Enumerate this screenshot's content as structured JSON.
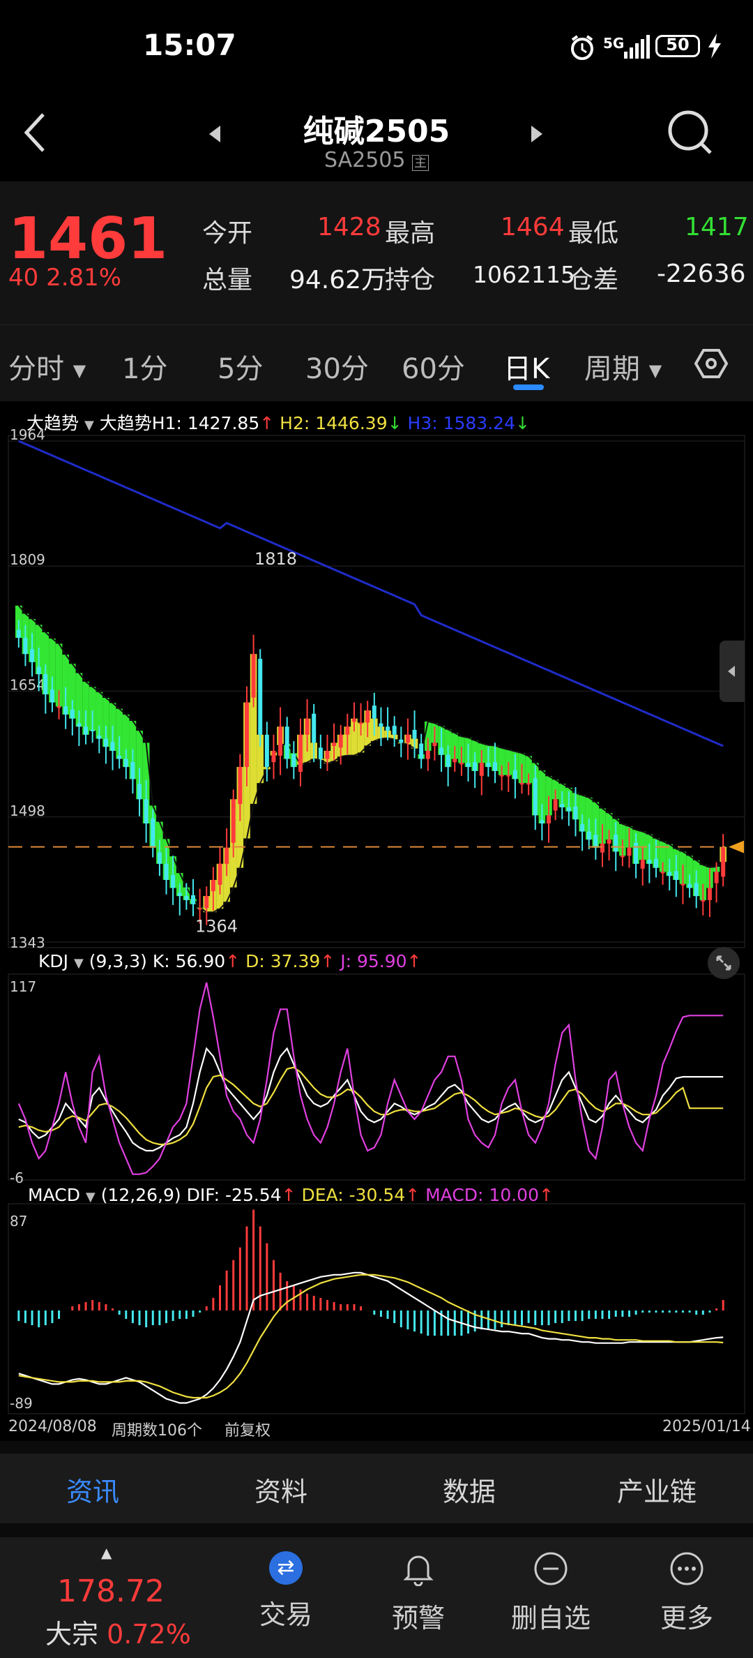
{
  "status": {
    "time": "15:07",
    "network": "5G",
    "battery": "50"
  },
  "header": {
    "title": "纯碱2505",
    "subtitle": "SA2505",
    "badge": "主"
  },
  "quote": {
    "price": "1461",
    "change": "40",
    "change_pct": "2.81%",
    "open_label": "今开",
    "open": "1428",
    "high_label": "最高",
    "high": "1464",
    "low_label": "最低",
    "low": "1417",
    "vol_label": "总量",
    "vol": "94.62万",
    "oi_label": "持仓",
    "oi": "1062115",
    "oi_diff_label": "仓差",
    "oi_diff": "-22636"
  },
  "tabs": [
    "分时",
    "1分",
    "5分",
    "30分",
    "60分",
    "日K",
    "周期"
  ],
  "active_tab": "日K",
  "main_legend": {
    "name": "大趋势",
    "h1": "大趋势H1: 1427.85",
    "h2": "H2: 1446.39",
    "h3": "H3: 1583.24"
  },
  "kdj_legend": {
    "name": "KDJ",
    "params": "(9,3,3)",
    "k": "K: 56.90",
    "d": "D: 37.39",
    "j": "J: 95.90"
  },
  "macd_legend": {
    "name": "MACD",
    "params": "(12,26,9)",
    "dif": "DIF: -25.54",
    "dea": "DEA: -30.54",
    "macd": "MACD: 10.00"
  },
  "bottom_info": {
    "start": "2024/08/08",
    "count": "周期数106个",
    "adj": "前复权",
    "end": "2025/01/14"
  },
  "bottom_tabs": [
    "资讯",
    "资料",
    "数据",
    "产业链"
  ],
  "footer": {
    "index_value": "178.72",
    "index_name": "大宗",
    "index_pct": "0.72%",
    "items": [
      "交易",
      "预警",
      "删自选",
      "更多"
    ]
  },
  "colors": {
    "up": "#ff3b3b",
    "down": "#44e8ee",
    "band_down": "#39ff39",
    "band_up": "#f5f53a",
    "h3": "#1f2cc8"
  },
  "chart_data": [
    {
      "type": "candlestick",
      "title": "",
      "ylim": [
        1343,
        1964
      ],
      "y_ticks": [
        "1964",
        "1809",
        "1654",
        "1498",
        "1343"
      ],
      "annotations": [
        "1818",
        "1364"
      ],
      "x_range": [
        "2024/08/08",
        "2025/01/14"
      ],
      "periods": 106,
      "last_close": 1461,
      "close": [
        1720,
        1700,
        1690,
        1675,
        1650,
        1640,
        1635,
        1625,
        1620,
        1610,
        1600,
        1605,
        1595,
        1585,
        1580,
        1570,
        1560,
        1545,
        1520,
        1490,
        1460,
        1440,
        1420,
        1410,
        1400,
        1395,
        1390,
        1385,
        1400,
        1420,
        1440,
        1460,
        1520,
        1560,
        1640,
        1700,
        1600,
        1560,
        1580,
        1610,
        1570,
        1560,
        1600,
        1620,
        1590,
        1570,
        1580,
        1590,
        1600,
        1610,
        1620,
        1615,
        1630,
        1620,
        1610,
        1605,
        1600,
        1590,
        1600,
        1595,
        1570,
        1580,
        1590,
        1575,
        1560,
        1570,
        1565,
        1560,
        1555,
        1565,
        1560,
        1555,
        1550,
        1550,
        1545,
        1540,
        1540,
        1500,
        1490,
        1500,
        1520,
        1510,
        1505,
        1495,
        1480,
        1470,
        1460,
        1465,
        1470,
        1455,
        1450,
        1460,
        1440,
        1445,
        1440,
        1435,
        1430,
        1425,
        1420,
        1415,
        1410,
        1400,
        1395,
        1410,
        1430,
        1461
      ]
    },
    {
      "type": "line",
      "title": "",
      "ylim": [
        -6,
        117
      ],
      "y_ticks": [
        "117",
        "-6"
      ],
      "series": [
        {
          "name": "K",
          "values": [
            30,
            28,
            22,
            18,
            20,
            25,
            30,
            40,
            35,
            30,
            25,
            45,
            50,
            42,
            35,
            28,
            22,
            15,
            12,
            10,
            10,
            12,
            15,
            18,
            20,
            25,
            40,
            60,
            75,
            70,
            60,
            50,
            45,
            40,
            35,
            30,
            35,
            45,
            60,
            70,
            75,
            65,
            55,
            45,
            40,
            38,
            40,
            45,
            50,
            55,
            45,
            35,
            30,
            28,
            30,
            35,
            40,
            38,
            35,
            33,
            35,
            38,
            40,
            45,
            50,
            52,
            48,
            40,
            35,
            30,
            28,
            30,
            35,
            38,
            40,
            35,
            30,
            28,
            30,
            35,
            45,
            55,
            60,
            50,
            40,
            30,
            28,
            32,
            40,
            45,
            40,
            35,
            30,
            28,
            32,
            36,
            45,
            50,
            56,
            57,
            57,
            57,
            57,
            57,
            57,
            57
          ]
        },
        {
          "name": "D",
          "values": [
            25,
            26,
            25,
            23,
            22,
            23,
            25,
            30,
            32,
            31,
            29,
            34,
            39,
            40,
            38,
            35,
            31,
            26,
            21,
            17,
            15,
            14,
            14,
            15,
            17,
            20,
            27,
            38,
            50,
            57,
            58,
            55,
            52,
            48,
            44,
            40,
            38,
            40,
            47,
            55,
            62,
            63,
            60,
            55,
            50,
            46,
            44,
            44,
            46,
            49,
            48,
            44,
            39,
            35,
            33,
            33,
            35,
            36,
            36,
            35,
            35,
            36,
            37,
            40,
            43,
            46,
            47,
            45,
            42,
            38,
            35,
            33,
            34,
            35,
            37,
            36,
            34,
            32,
            31,
            32,
            36,
            42,
            48,
            49,
            46,
            41,
            37,
            35,
            37,
            40,
            40,
            38,
            35,
            33,
            33,
            34,
            38,
            42,
            47,
            50,
            37,
            37,
            37,
            37,
            37,
            37
          ]
        },
        {
          "name": "J",
          "values": [
            40,
            30,
            15,
            5,
            10,
            25,
            40,
            60,
            40,
            25,
            15,
            60,
            70,
            45,
            30,
            15,
            5,
            -5,
            -5,
            -4,
            0,
            5,
            15,
            25,
            30,
            40,
            70,
            100,
            117,
            95,
            70,
            45,
            35,
            30,
            20,
            15,
            30,
            55,
            85,
            100,
            100,
            70,
            45,
            30,
            20,
            15,
            25,
            40,
            60,
            75,
            45,
            20,
            10,
            12,
            20,
            40,
            55,
            45,
            35,
            30,
            35,
            45,
            55,
            60,
            70,
            70,
            55,
            30,
            20,
            15,
            12,
            20,
            40,
            50,
            55,
            35,
            20,
            15,
            25,
            40,
            65,
            85,
            90,
            55,
            30,
            10,
            5,
            25,
            55,
            60,
            40,
            25,
            15,
            10,
            30,
            45,
            65,
            75,
            86,
            95,
            96,
            96,
            96,
            96,
            96,
            96
          ]
        }
      ]
    },
    {
      "type": "bar",
      "title": "",
      "ylim": [
        -89,
        87
      ],
      "y_ticks": [
        "87",
        "-89"
      ],
      "series": [
        {
          "name": "DIF",
          "values": [
            -60,
            -62,
            -64,
            -66,
            -68,
            -70,
            -70,
            -68,
            -66,
            -65,
            -66,
            -68,
            -70,
            -70,
            -68,
            -66,
            -64,
            -66,
            -68,
            -72,
            -76,
            -80,
            -84,
            -86,
            -88,
            -88,
            -86,
            -84,
            -80,
            -74,
            -66,
            -56,
            -44,
            -30,
            -10,
            10,
            14,
            16,
            18,
            20,
            22,
            24,
            26,
            28,
            30,
            32,
            33,
            34,
            34,
            35,
            36,
            36,
            34,
            32,
            30,
            28,
            24,
            20,
            16,
            12,
            8,
            4,
            0,
            -4,
            -8,
            -10,
            -12,
            -14,
            -16,
            -17,
            -18,
            -19,
            -20,
            -20,
            -21,
            -22,
            -22,
            -24,
            -26,
            -27,
            -27,
            -28,
            -28,
            -29,
            -30,
            -30,
            -31,
            -31,
            -31,
            -31,
            -31,
            -30,
            -30,
            -30,
            -30,
            -30,
            -30,
            -30,
            -30,
            -30,
            -30,
            -29,
            -28,
            -27,
            -26,
            -25.54
          ]
        },
        {
          "name": "DEA",
          "values": [
            -62,
            -63,
            -64,
            -65,
            -66,
            -67,
            -68,
            -68,
            -68,
            -67,
            -67,
            -67,
            -68,
            -68,
            -68,
            -68,
            -67,
            -67,
            -67,
            -68,
            -70,
            -72,
            -75,
            -78,
            -80,
            -82,
            -83,
            -83,
            -83,
            -81,
            -78,
            -74,
            -68,
            -60,
            -50,
            -38,
            -26,
            -16,
            -6,
            2,
            8,
            12,
            16,
            20,
            23,
            26,
            28,
            30,
            31,
            32,
            33,
            34,
            34,
            34,
            33,
            32,
            31,
            29,
            27,
            24,
            21,
            18,
            15,
            12,
            8,
            5,
            2,
            -1,
            -4,
            -6,
            -8,
            -10,
            -12,
            -13,
            -14,
            -15,
            -16,
            -17,
            -19,
            -20,
            -21,
            -22,
            -23,
            -24,
            -25,
            -26,
            -26,
            -27,
            -27,
            -28,
            -28,
            -28,
            -28,
            -29,
            -29,
            -29,
            -29,
            -29,
            -30,
            -30,
            -30,
            -30,
            -30,
            -30,
            -30,
            -30.54
          ]
        },
        {
          "name": "MACD",
          "values": [
            -10,
            -12,
            -14,
            -16,
            -14,
            -12,
            -8,
            0,
            4,
            6,
            8,
            10,
            8,
            6,
            2,
            -4,
            -8,
            -12,
            -14,
            -16,
            -14,
            -14,
            -12,
            -10,
            -8,
            -8,
            -6,
            -2,
            4,
            12,
            24,
            38,
            48,
            60,
            80,
            96,
            80,
            64,
            48,
            36,
            28,
            24,
            20,
            16,
            14,
            12,
            10,
            8,
            6,
            6,
            6,
            4,
            0,
            -4,
            -6,
            -8,
            -12,
            -16,
            -18,
            -20,
            -22,
            -24,
            -24,
            -24,
            -24,
            -24,
            -24,
            -22,
            -20,
            -18,
            -18,
            -18,
            -16,
            -14,
            -14,
            -14,
            -12,
            -14,
            -14,
            -14,
            -12,
            -12,
            -10,
            -10,
            -10,
            -8,
            -8,
            -8,
            -8,
            -6,
            -6,
            -6,
            -4,
            -2,
            -2,
            -2,
            -2,
            -2,
            -2,
            -2,
            -2,
            -4,
            -4,
            -2,
            2,
            10
          ]
        }
      ]
    }
  ]
}
